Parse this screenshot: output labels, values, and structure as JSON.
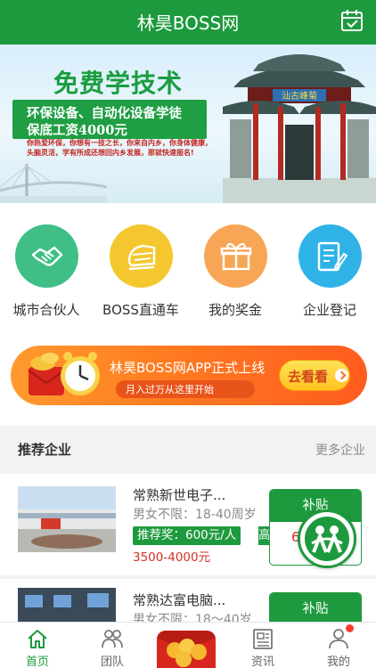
{
  "header": {
    "title": "林昊BOSS网",
    "calendar_icon": "calendar-check-icon"
  },
  "banner": {
    "headline": "免费学技术",
    "line1": "环保设备、自动化设备学徒",
    "line2": "保底工资4000元",
    "desc": "你热爱环保，你想有一技之长，你来自内乡，你身体健康，头脑灵活，学有所成还想回内乡发展，那就快速报名!",
    "gate_sign": "汕古峰菊",
    "slides": 4,
    "active_slide": 2
  },
  "quick_menu": [
    {
      "label": "城市合伙人",
      "icon": "handshake-icon",
      "color": "#3fbf86"
    },
    {
      "label": "BOSS直通车",
      "icon": "train-icon",
      "color": "#f4c72e"
    },
    {
      "label": "我的奖金",
      "icon": "gift-icon",
      "color": "#f7a656"
    },
    {
      "label": "企业登记",
      "icon": "register-form-icon",
      "color": "#2fb3e7"
    }
  ],
  "promo": {
    "title": "林昊BOSS网APP正式上线",
    "subtitle": "月入过万从这里开始",
    "cta": "去看看"
  },
  "section": {
    "title": "推荐企业",
    "more": "更多企业"
  },
  "jobs": [
    {
      "company": "常熟新世电子...",
      "requirement": "男女不限：18-40周岁",
      "bonus": "推荐奖：600元/人",
      "tag2": "高",
      "salary": "3500-4000元",
      "subsidy_label": "补贴",
      "subsidy_amount": "6"
    },
    {
      "company": "常熟达富电脑...",
      "requirement": "男女不限：18～40岁",
      "subsidy_label": "补贴"
    }
  ],
  "tabbar": [
    {
      "label": "首页",
      "icon": "home-icon",
      "active": true
    },
    {
      "label": "团队",
      "icon": "team-icon",
      "active": false
    },
    {
      "label": "",
      "icon": "red-packet-icon",
      "active": false
    },
    {
      "label": "资讯",
      "icon": "news-icon",
      "active": false
    },
    {
      "label": "我的",
      "icon": "profile-icon",
      "active": false
    }
  ],
  "colors": {
    "brand_green": "#1e9a3e",
    "salary_red": "#d62f24",
    "promo_orange": "#ff7a20"
  }
}
